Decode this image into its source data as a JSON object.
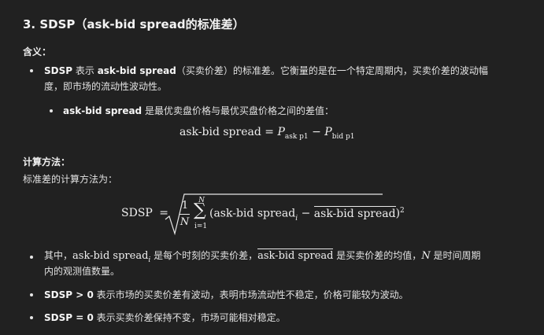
{
  "heading": "3. SDSP（ask-bid spread的标准差）",
  "meaning_label": "含义：",
  "item1": {
    "prefix": "SDSP",
    "text_a": " 表示 ",
    "term": "ask-bid spread",
    "text_b": "（买卖价差）的标准差。它衡量的是在一个特定周期内，买卖价差的波动幅",
    "line2": "度，即市场的流动性波动性。"
  },
  "subitem": {
    "term": "ask-bid spread",
    "text": " 是最优卖盘价格与最优买盘价格之间的差值："
  },
  "formula1": {
    "lhs": "ask-bid spread",
    "eq": "=",
    "p": "P",
    "sub1": "ask p1",
    "minus": "−",
    "sub2": "bid p1"
  },
  "method_label": "计算方法：",
  "method_text": "标准差的计算方法为：",
  "formula2": {
    "lhs": "SDSP",
    "eq": "=",
    "num": "1",
    "den": "N",
    "sum_top": "N",
    "sum_sym": "∑",
    "sum_bottom": "i=1",
    "term_open": "(ask-bid spread",
    "term_sub": "i",
    "minus": "−",
    "mean": "ask-bid spread",
    "close": ")",
    "pow": "2"
  },
  "bullets": [
    {
      "prefix": "其中，",
      "term": "ask-bid spread",
      "sub": "i",
      "text_a": " 是每个时刻的买卖价差，",
      "mean": "ask-bid spread",
      "text_b": " 是买卖价差的均值，",
      "n": "N",
      "text_c": " 是时间周期",
      "line2": "内的观测值数量。"
    },
    {
      "bold": "SDSP > 0",
      "text": " 表示市场的买卖价差有波动，表明市场流动性不稳定，价格可能较为波动。"
    },
    {
      "bold": "SDSP = 0",
      "text": " 表示买卖价差保持不变，市场可能相对稳定。"
    }
  ]
}
